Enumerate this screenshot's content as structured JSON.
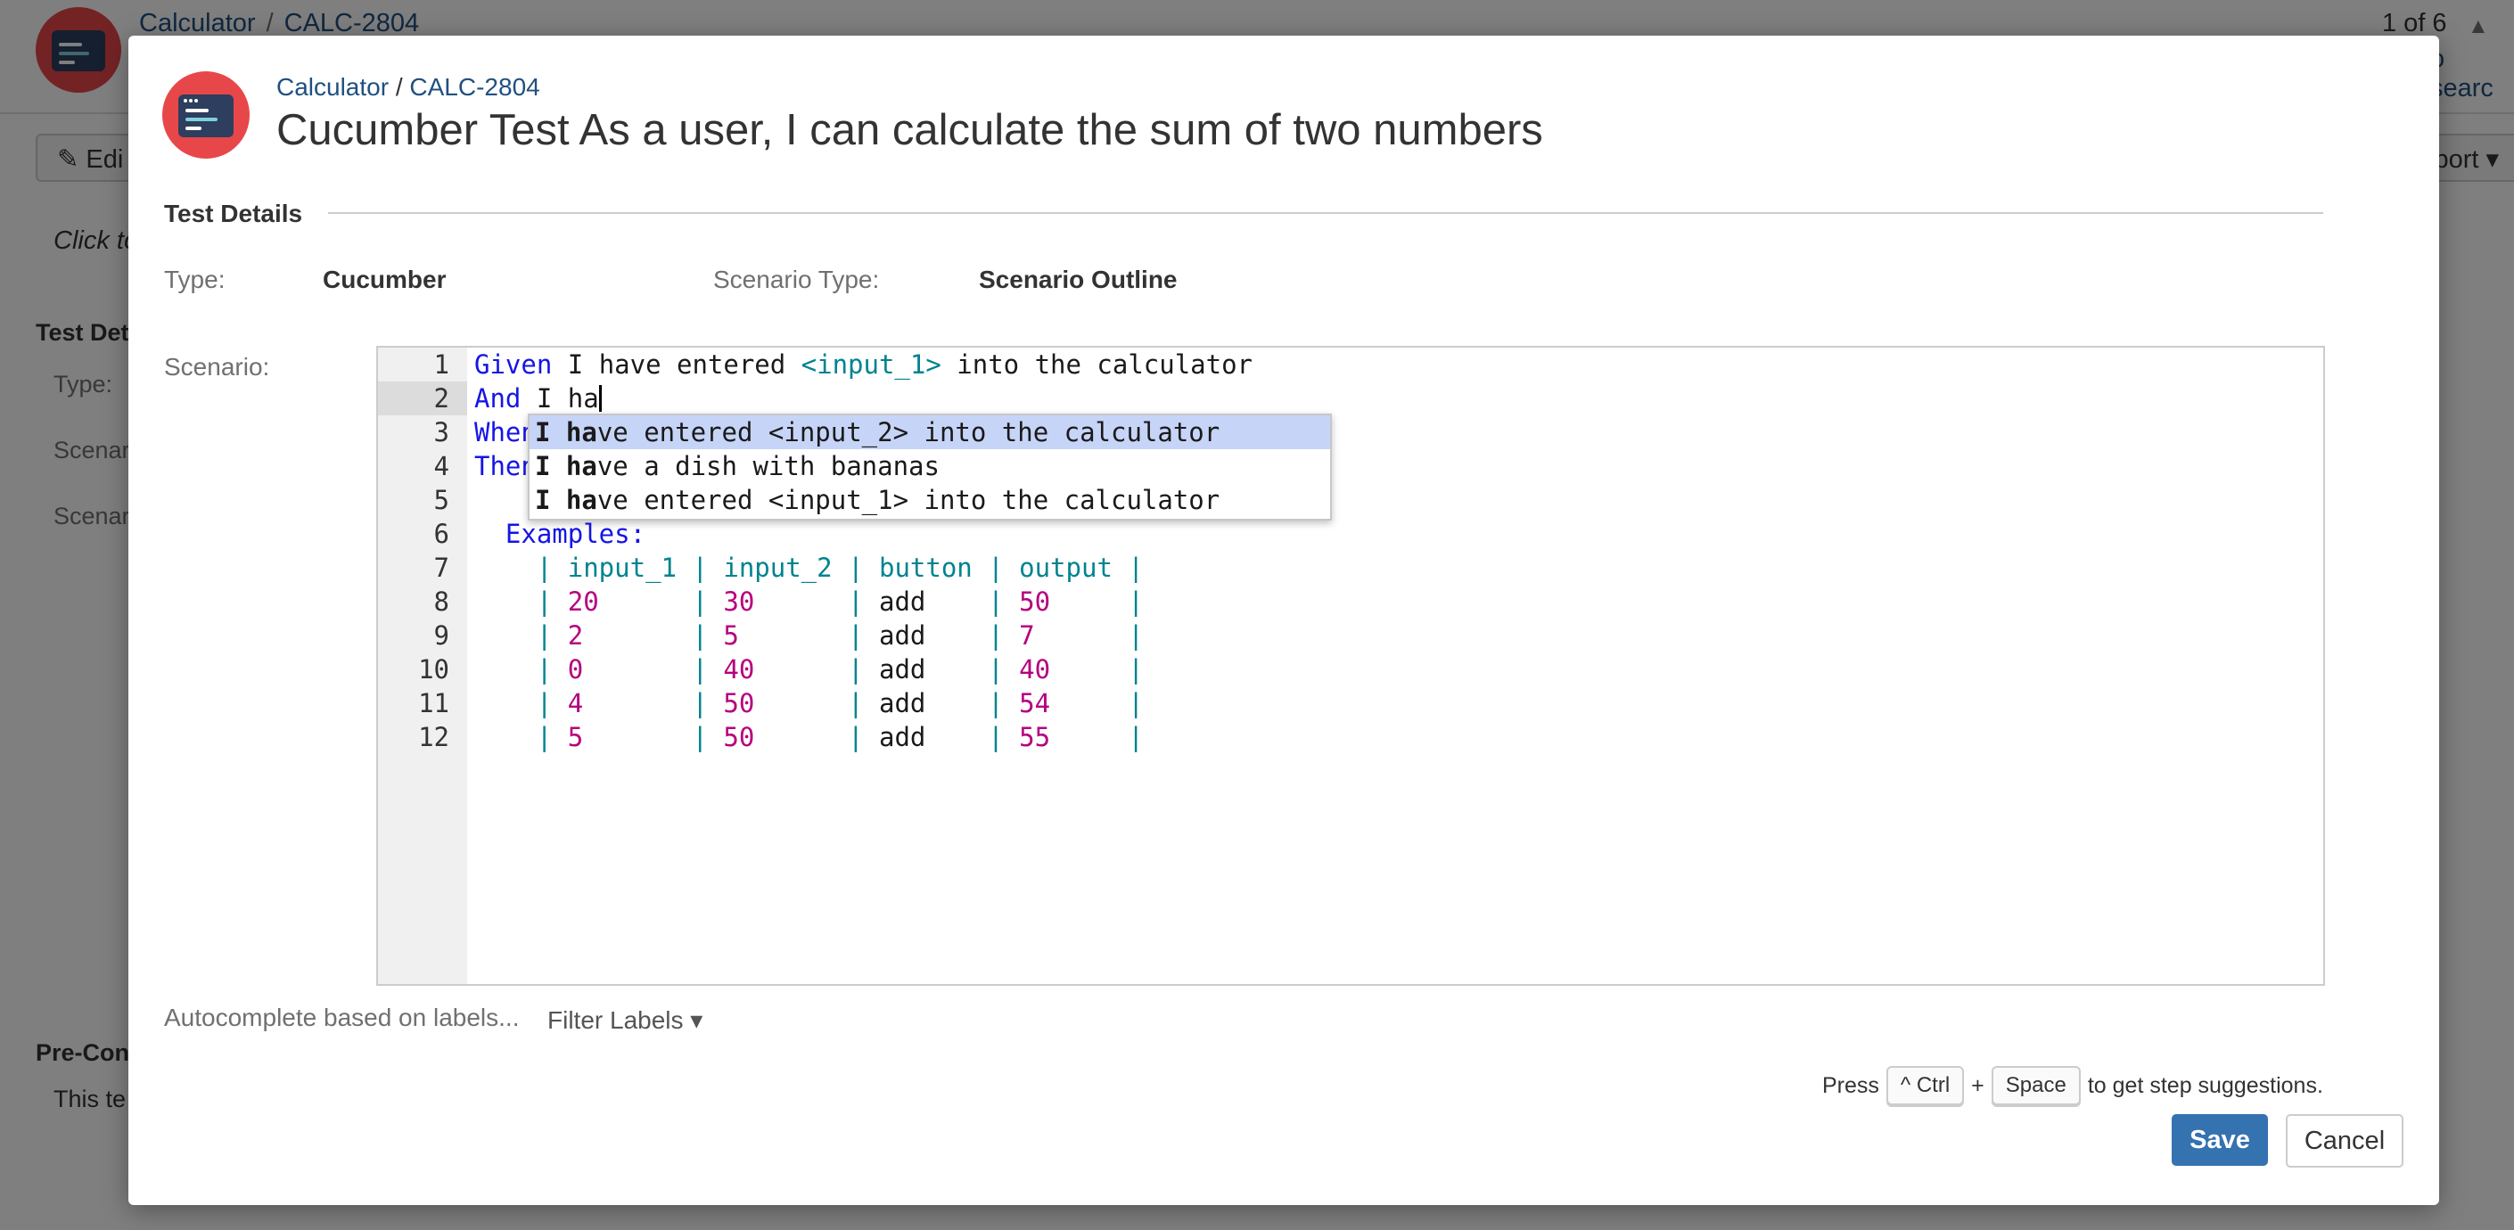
{
  "background": {
    "breadcrumb": {
      "project": "Calculator",
      "separator": "/",
      "issue": "CALC-2804"
    },
    "pager": "1 of 6",
    "search_fragment": "o searc",
    "edit_label": "Edi",
    "export_label": "xport",
    "hint_fragment": "Click to",
    "test_details_fragment": "Test Det",
    "type_fragment": "Type:",
    "scenario_type_fragment": "Scenar",
    "scenario_fragment": "Scenar",
    "precond_fragment": "Pre-Con",
    "this_test_fragment": "This te"
  },
  "dialog": {
    "breadcrumb": {
      "project": "Calculator",
      "separator": " / ",
      "issue": "CALC-2804"
    },
    "title": "Cucumber Test As a user, I can calculate the sum of two numbers",
    "section_title": "Test Details",
    "fields": {
      "type_label": "Type:",
      "type_value": "Cucumber",
      "scenario_type_label": "Scenario Type:",
      "scenario_type_value": "Scenario Outline",
      "scenario_label": "Scenario:"
    },
    "editor": {
      "line_numbers": [
        "1",
        "2",
        "3",
        "4",
        "5",
        "6",
        "7",
        "8",
        "9",
        "10",
        "11",
        "12"
      ],
      "line1": {
        "keyword": "Given",
        "text1": " I have entered ",
        "param": "<input_1>",
        "text2": " into the calculator"
      },
      "line2": {
        "keyword": "And",
        "text": " I ha"
      },
      "line3": {
        "keyword": "When"
      },
      "line4": {
        "keyword": "Then"
      },
      "line6": {
        "keyword": "Examples:"
      },
      "table": {
        "header": [
          "input_1",
          "input_2",
          "button",
          "output"
        ],
        "rows": [
          [
            "20",
            "30",
            "add",
            "50"
          ],
          [
            "2",
            "5",
            "add",
            "7"
          ],
          [
            "0",
            "40",
            "add",
            "40"
          ],
          [
            "4",
            "50",
            "add",
            "54"
          ],
          [
            "5",
            "50",
            "add",
            "55"
          ]
        ]
      }
    },
    "autocomplete": {
      "items": [
        {
          "match": "I ha",
          "rest": "ve entered <input_2> into the calculator",
          "selected": true
        },
        {
          "match": "I ha",
          "rest": "ve a dish with bananas",
          "selected": false
        },
        {
          "match": "I ha",
          "rest": "ve entered <input_1> into the calculator",
          "selected": false
        }
      ]
    },
    "autocomplete_label": "Autocomplete based on labels...",
    "filter_labels": "Filter Labels",
    "hint": {
      "press": "Press",
      "key1": "^ Ctrl",
      "plus": "+",
      "key2": "Space",
      "suffix": "to get step suggestions."
    },
    "save_label": "Save",
    "cancel_label": "Cancel"
  }
}
